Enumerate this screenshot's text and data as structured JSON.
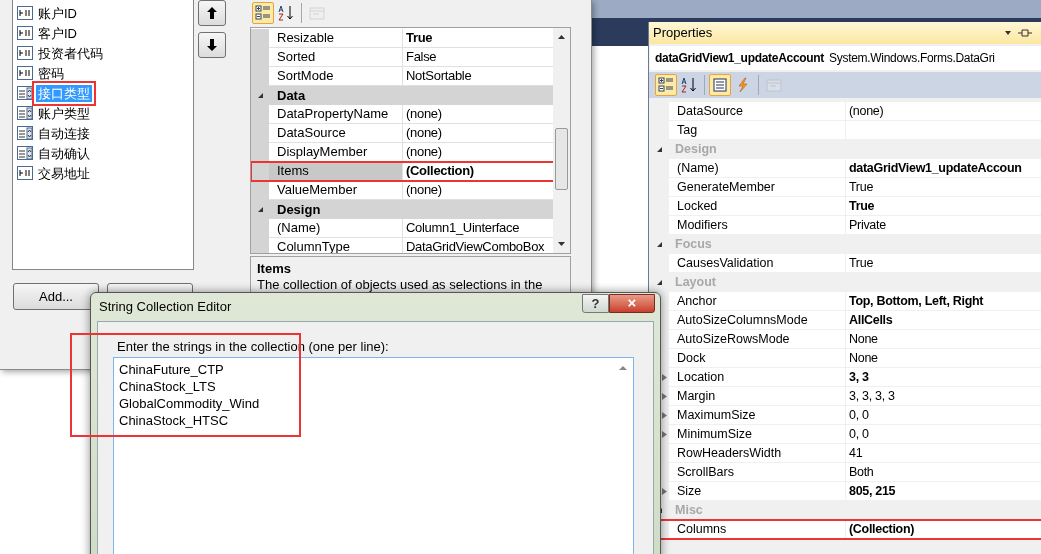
{
  "column_editor": {
    "members": [
      {
        "label": "账户ID",
        "kind": "textbox",
        "selected": false,
        "highlighted": false
      },
      {
        "label": "客户ID",
        "kind": "textbox",
        "selected": false,
        "highlighted": false
      },
      {
        "label": "投资者代码",
        "kind": "textbox",
        "selected": false,
        "highlighted": false
      },
      {
        "label": "密码",
        "kind": "textbox",
        "selected": false,
        "highlighted": false
      },
      {
        "label": "接口类型",
        "kind": "combobox",
        "selected": true,
        "highlighted": true
      },
      {
        "label": "账户类型",
        "kind": "combobox",
        "selected": false,
        "highlighted": false
      },
      {
        "label": "自动连接",
        "kind": "combobox",
        "selected": false,
        "highlighted": false
      },
      {
        "label": "自动确认",
        "kind": "combobox",
        "selected": false,
        "highlighted": false
      },
      {
        "label": "交易地址",
        "kind": "textbox",
        "selected": false,
        "highlighted": false
      }
    ],
    "add_button": "Add...",
    "grid": {
      "toolbar": [
        {
          "kind": "categorized",
          "selected": true,
          "disabled": false
        },
        {
          "kind": "alphabetical",
          "selected": false,
          "disabled": false
        },
        {
          "kind": "pages",
          "selected": false,
          "disabled": true
        }
      ],
      "rows": [
        {
          "kind": "property",
          "name": "Resizable",
          "value": "True",
          "bold": true,
          "selected": false,
          "highlighted": false
        },
        {
          "kind": "property",
          "name": "Sorted",
          "value": "False",
          "bold": false,
          "selected": false,
          "highlighted": false
        },
        {
          "kind": "property",
          "name": "SortMode",
          "value": "NotSortable",
          "bold": false,
          "selected": false,
          "highlighted": false
        },
        {
          "kind": "category",
          "name": "Data",
          "expanded": true
        },
        {
          "kind": "property",
          "name": "DataPropertyName",
          "value": "(none)",
          "bold": false,
          "selected": false,
          "highlighted": false
        },
        {
          "kind": "property",
          "name": "DataSource",
          "value": "(none)",
          "bold": false,
          "selected": false,
          "highlighted": false
        },
        {
          "kind": "property",
          "name": "DisplayMember",
          "value": "(none)",
          "bold": false,
          "selected": false,
          "highlighted": false
        },
        {
          "kind": "property",
          "name": "Items",
          "value": "(Collection)",
          "bold": true,
          "selected": true,
          "highlighted": true
        },
        {
          "kind": "property",
          "name": "ValueMember",
          "value": "(none)",
          "bold": false,
          "selected": false,
          "highlighted": false
        },
        {
          "kind": "category",
          "name": "Design",
          "expanded": true
        },
        {
          "kind": "property",
          "name": "(Name)",
          "value": "Column1_Uinterface",
          "bold": false,
          "selected": false,
          "highlighted": false
        },
        {
          "kind": "property",
          "name": "ColumnType",
          "value": "DataGridViewComboBox",
          "bold": false,
          "selected": false,
          "highlighted": false
        }
      ],
      "description": {
        "title": "Items",
        "text": "The collection of objects used as selections in the"
      }
    }
  },
  "string_editor": {
    "title": "String Collection Editor",
    "help_button": "?",
    "close_button": "×",
    "prompt": "Enter the strings in the collection (one per line):",
    "highlighted": true,
    "lines": [
      "ChinaFuture_CTP",
      "ChinaStock_LTS",
      "GlobalCommodity_Wind",
      "ChinaStock_HTSC"
    ]
  },
  "properties": {
    "title": "Properties",
    "object_name": "dataGridView1_updateAccount",
    "object_type": "System.Windows.Forms.DataGri",
    "toolbar": [
      {
        "kind": "categorized",
        "selected": true,
        "disabled": false
      },
      {
        "kind": "alphabetical",
        "selected": false,
        "disabled": false
      },
      {
        "kind": "properties",
        "selected": true,
        "disabled": false
      },
      {
        "kind": "events",
        "selected": false,
        "disabled": false
      },
      {
        "kind": "pages",
        "selected": false,
        "disabled": true
      }
    ],
    "rows": [
      {
        "kind": "property",
        "name": "DataSource",
        "value": "(none)",
        "bold": false,
        "expandable": false,
        "highlighted": false
      },
      {
        "kind": "property",
        "name": "Tag",
        "expandable": false,
        "highlighted": false
      },
      {
        "kind": "category",
        "name": "Design",
        "expanded": true
      },
      {
        "kind": "property",
        "name": "(Name)",
        "value": "dataGridView1_updateAccoun",
        "bold": true,
        "expandable": false,
        "highlighted": false
      },
      {
        "kind": "property",
        "name": "GenerateMember",
        "value": "True",
        "bold": false,
        "expandable": false,
        "highlighted": false
      },
      {
        "kind": "property",
        "name": "Locked",
        "value": "True",
        "bold": true,
        "expandable": false,
        "highlighted": false
      },
      {
        "kind": "property",
        "name": "Modifiers",
        "value": "Private",
        "bold": false,
        "expandable": false,
        "highlighted": false
      },
      {
        "kind": "category",
        "name": "Focus",
        "expanded": true
      },
      {
        "kind": "property",
        "name": "CausesValidation",
        "value": "True",
        "bold": false,
        "expandable": false,
        "highlighted": false
      },
      {
        "kind": "category",
        "name": "Layout",
        "expanded": true
      },
      {
        "kind": "property",
        "name": "Anchor",
        "value": "Top, Bottom, Left, Right",
        "bold": true,
        "expandable": false,
        "highlighted": false
      },
      {
        "kind": "property",
        "name": "AutoSizeColumnsMode",
        "value": "AllCells",
        "bold": true,
        "expandable": false,
        "highlighted": false
      },
      {
        "kind": "property",
        "name": "AutoSizeRowsMode",
        "value": "None",
        "bold": false,
        "expandable": false,
        "highlighted": false
      },
      {
        "kind": "property",
        "name": "Dock",
        "value": "None",
        "bold": false,
        "expandable": false,
        "highlighted": false
      },
      {
        "kind": "property",
        "name": "Location",
        "value": "3, 3",
        "bold": true,
        "expandable": true,
        "highlighted": false
      },
      {
        "kind": "property",
        "name": "Margin",
        "value": "3, 3, 3, 3",
        "bold": false,
        "expandable": true,
        "highlighted": false
      },
      {
        "kind": "property",
        "name": "MaximumSize",
        "value": "0, 0",
        "bold": false,
        "expandable": true,
        "highlighted": false
      },
      {
        "kind": "property",
        "name": "MinimumSize",
        "value": "0, 0",
        "bold": false,
        "expandable": true,
        "highlighted": false
      },
      {
        "kind": "property",
        "name": "RowHeadersWidth",
        "value": "41",
        "bold": false,
        "expandable": false,
        "highlighted": false
      },
      {
        "kind": "property",
        "name": "ScrollBars",
        "value": "Both",
        "bold": false,
        "expandable": false,
        "highlighted": false
      },
      {
        "kind": "property",
        "name": "Size",
        "value": "805, 215",
        "bold": true,
        "expandable": true,
        "highlighted": false
      },
      {
        "kind": "category",
        "name": "Misc",
        "expanded": true
      },
      {
        "kind": "property",
        "name": "Columns",
        "value": "(Collection)",
        "bold": true,
        "expandable": false,
        "highlighted": true
      }
    ]
  }
}
